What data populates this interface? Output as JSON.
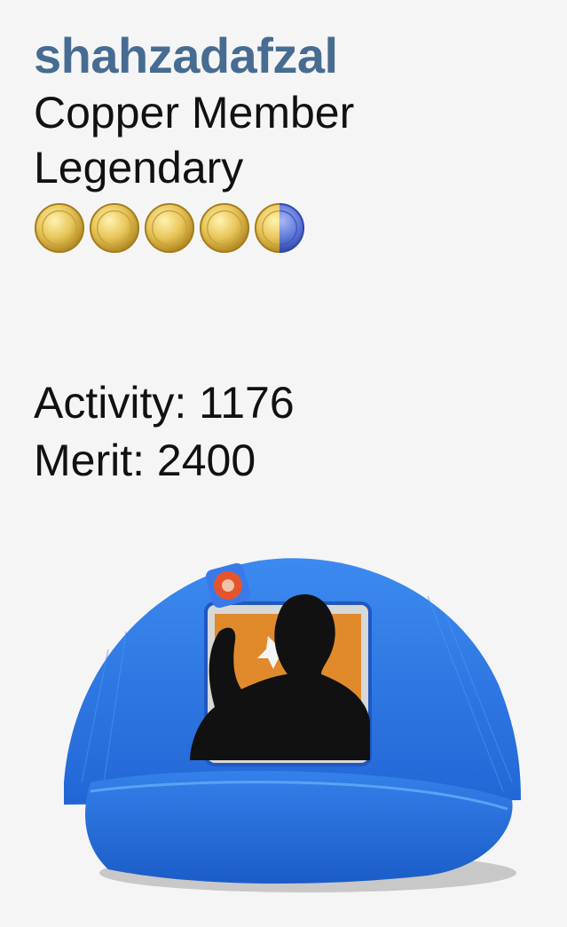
{
  "user": {
    "username": "shahzadafzal",
    "rank": "Copper Member",
    "rank_title": "Legendary",
    "rank_coins": {
      "full": 4,
      "half": 1
    }
  },
  "stats": {
    "activity_label": "Activity:",
    "activity_value": "1176",
    "merit_label": "Merit:",
    "merit_value": "2400"
  },
  "colors": {
    "username": "#476c92",
    "coin_gold": "#e8c65a",
    "coin_half_blue": "#5b74d8",
    "cap_blue": "#2f7be6"
  },
  "avatar": {
    "icon": "blue-cap-silhouette-avatar"
  }
}
